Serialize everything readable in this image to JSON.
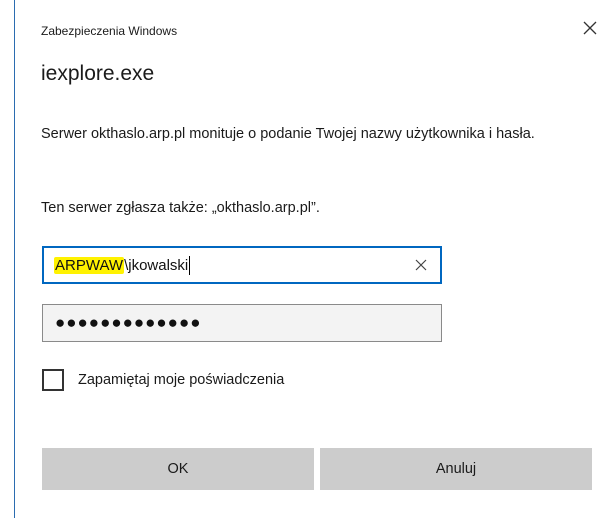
{
  "window": {
    "title": "Zabezpieczenia Windows",
    "close_icon": "close-icon"
  },
  "app_title": "iexplore.exe",
  "message": {
    "line1": "Serwer okthaslo.arp.pl monituje o podanie Twojej nazwy użytkownika i hasła.",
    "line2": "Ten serwer zgłasza także: „okthaslo.arp.pl”."
  },
  "username": {
    "domain_part": "ARPWAW",
    "user_part": "\\jkowalski",
    "clear_icon": "clear-icon",
    "highlight_color": "#fff200"
  },
  "password": {
    "masked": "●●●●●●●●●●●●●"
  },
  "remember": {
    "label": "Zapamiętaj moje poświadczenia",
    "checked": false
  },
  "buttons": {
    "ok_label": "OK",
    "cancel_label": "Anuluj"
  },
  "colors": {
    "focus_border": "#0067c0",
    "button_bg": "#cccccc",
    "dialog_edge": "#2b6cb0"
  }
}
